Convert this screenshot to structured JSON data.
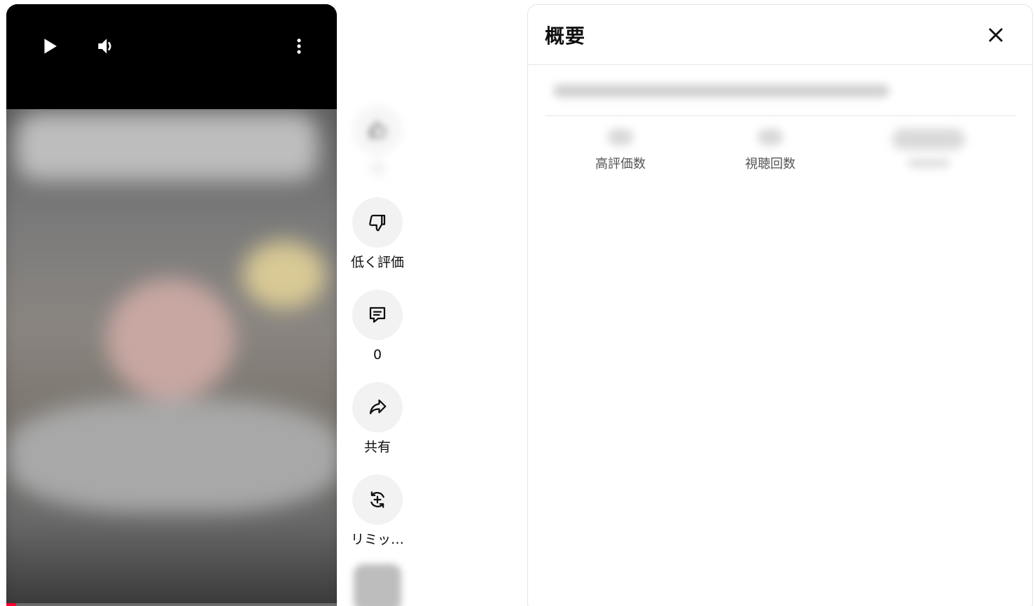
{
  "player": {
    "controls": {
      "play_icon": "play-icon",
      "volume_icon": "volume-icon",
      "more_icon": "more-vertical-icon"
    },
    "progress_fraction": 0.03,
    "accent_color": "#ff0033"
  },
  "actions": {
    "dislike": {
      "label": "低く評価",
      "icon": "thumbs-down-icon"
    },
    "comments": {
      "label": "0",
      "icon": "comment-icon"
    },
    "share": {
      "label": "共有",
      "icon": "share-arrow-icon"
    },
    "remix": {
      "label": "リミッ…",
      "icon": "remix-icon"
    }
  },
  "panel": {
    "title": "概要",
    "close_icon": "close-icon",
    "stats": {
      "likes_label": "高評価数",
      "views_label": "視聴回数"
    }
  }
}
